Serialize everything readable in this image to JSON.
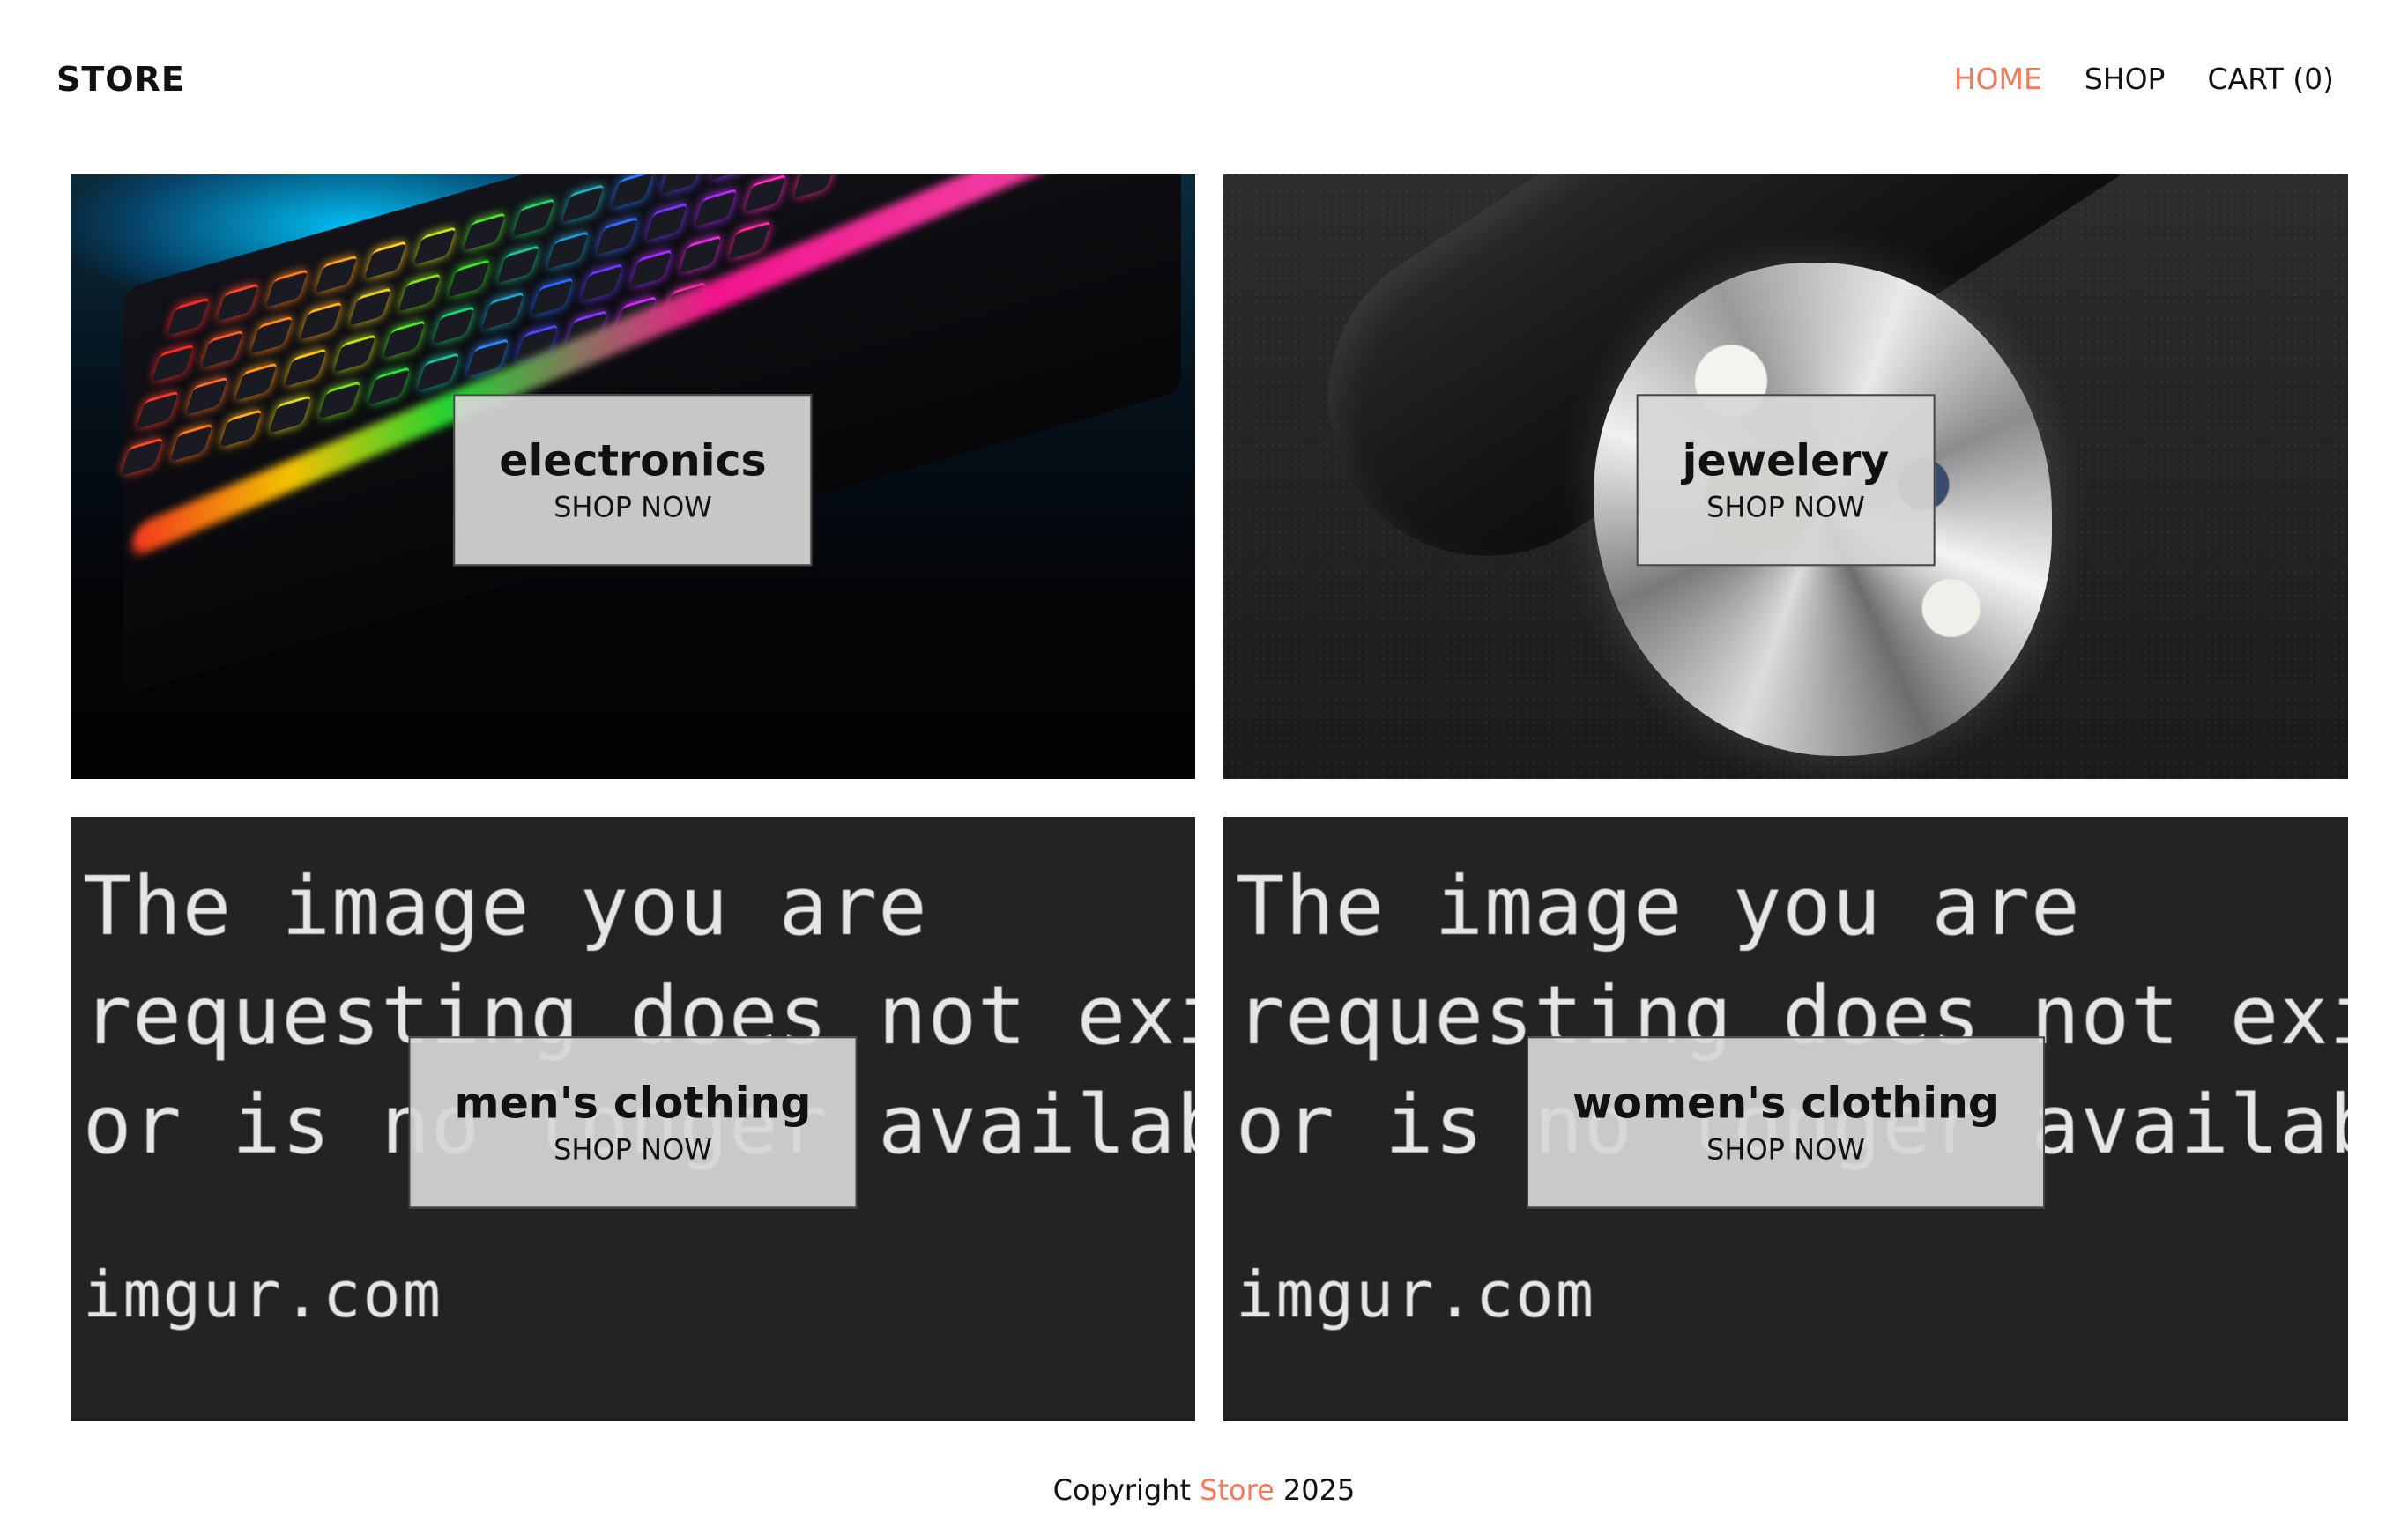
{
  "header": {
    "logo": "STORE",
    "nav": [
      {
        "label": "HOME",
        "active": true
      },
      {
        "label": "SHOP",
        "active": false
      },
      {
        "label": "CART (0)",
        "active": false
      }
    ]
  },
  "categories": [
    {
      "name": "electronics",
      "cta": "SHOP NOW",
      "image": "keyboard-photo"
    },
    {
      "name": "jewelery",
      "cta": "SHOP NOW",
      "image": "ring-photo"
    },
    {
      "name": "men's clothing",
      "cta": "SHOP NOW",
      "image": "image-unavailable-placeholder"
    },
    {
      "name": "women's clothing",
      "cta": "SHOP NOW",
      "image": "image-unavailable-placeholder"
    }
  ],
  "placeholder_image": {
    "lines": [
      "The image you are",
      "requesting does not exist",
      "or is no longer available."
    ],
    "domain": "imgur.com"
  },
  "footer": {
    "prefix": "Copyright",
    "brand": "Store",
    "year": "2025"
  },
  "colors": {
    "accent": "#f07a5e",
    "overlay": "#d6d6d6",
    "text": "#111111"
  }
}
